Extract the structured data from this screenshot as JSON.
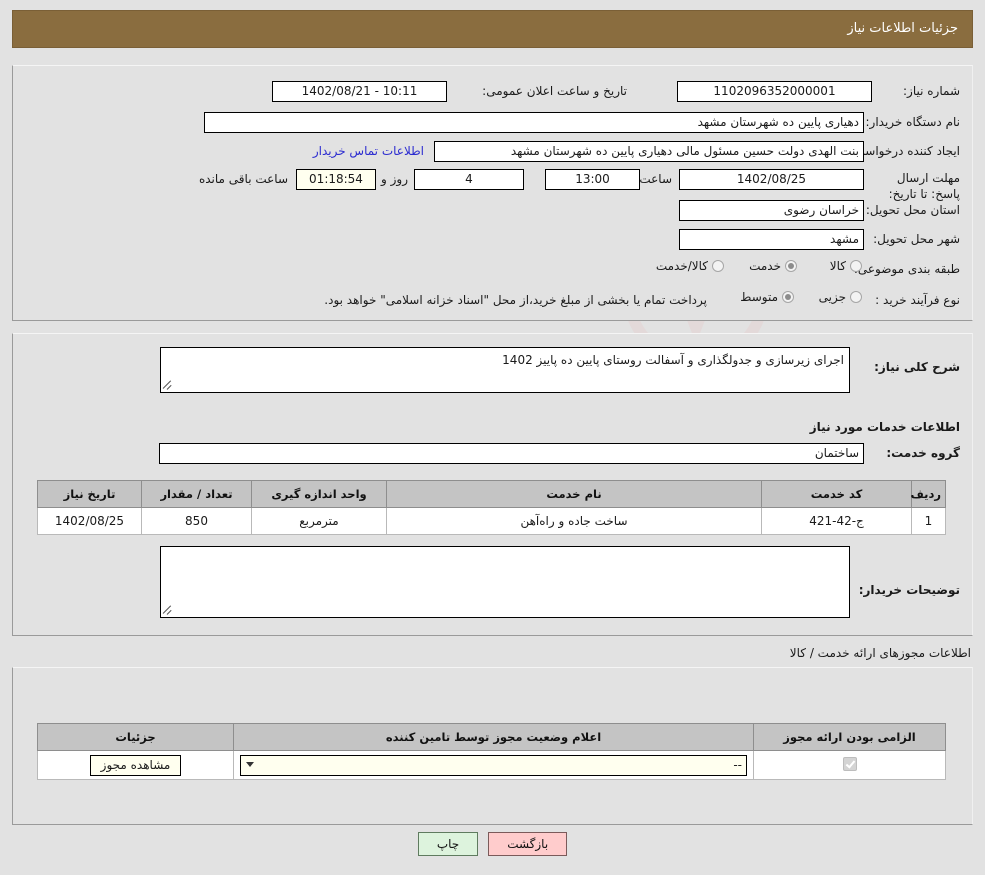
{
  "header": {
    "title": "جزئیات اطلاعات نیاز"
  },
  "watermark": {
    "text": "AriaTender.net"
  },
  "fields": {
    "need_number_label": "شماره نیاز:",
    "need_number_value": "1102096352000001",
    "public_announce_label": "تاریخ و ساعت اعلان عمومی:",
    "public_announce_value": "1402/08/21 - 10:11",
    "buyer_org_label": "نام دستگاه خریدار:",
    "buyer_org_value": "دهیاری پایین ده  شهرستان مشهد",
    "creator_label": "ایجاد کننده درخواست:",
    "creator_value": "بنت الهدی دولت حسین مسئول مالی  دهیاری پایین ده  شهرستان مشهد",
    "contact_link": "اطلاعات تماس خرید‌ار",
    "deadline_label": "مهلت ارسال پاسخ: تا تاریخ:",
    "deadline_date": "1402/08/25",
    "hour_label": "ساعت",
    "deadline_time": "13:00",
    "days_value": "4",
    "days_and_label": "روز و",
    "countdown_value": "01:18:54",
    "remaining_label": "ساعت باقی مانده",
    "province_label": "استان محل تحویل:",
    "province_value": "خراسان رضوی",
    "city_label": "شهر محل تحویل:",
    "city_value": "مشهد",
    "category_label": "طبقه بندی موضوعی:",
    "process_label": "نوع فرآیند خرید :",
    "payment_note": "پرداخت تمام یا بخشی از مبلغ خرید،از محل \"اسناد خزانه اسلامی\" خواهد بود."
  },
  "category_options": [
    {
      "label": "کالا",
      "selected": false
    },
    {
      "label": "خدمت",
      "selected": true
    },
    {
      "label": "کالا/خدمت",
      "selected": false
    }
  ],
  "process_options": [
    {
      "label": "جزیی",
      "selected": false
    },
    {
      "label": "متوسط",
      "selected": true
    }
  ],
  "detail": {
    "summary_label": "شرح کلی نیاز:",
    "summary_value": "اجرای زیرسازی و جدولگذاری و آسفالت روستای پایین ده پاییز 1402",
    "services_heading": "اطلاعات خدمات مورد نیاز",
    "service_group_label": "گروه خدمت:",
    "service_group_value": "ساختمان",
    "buyer_notes_label": "توضیحات خریدار:",
    "buyer_notes_value": ""
  },
  "services_table": {
    "columns": [
      "ردیف",
      "کد خدمت",
      "نام خدمت",
      "واحد اندازه گیری",
      "تعداد / مقدار",
      "تاریخ نیاز"
    ],
    "rows": [
      {
        "row": "1",
        "code": "ج-42-421",
        "name": "ساخت جاده و راه‌آهن",
        "unit": "مترمربع",
        "qty": "850",
        "date": "1402/08/25"
      }
    ]
  },
  "permits": {
    "section_note": "اطلاعات مجوزهای ارائه خدمت / کالا",
    "columns": [
      "الزامی بودن ارائه مجوز",
      "اعلام وضعیت مجوز توسط تامین کننده",
      "جزئیات"
    ],
    "rows": [
      {
        "required": true,
        "status_value": "--",
        "details_button": "مشاهده مجوز"
      }
    ]
  },
  "footer": {
    "back_label": "بازگشت",
    "print_label": "چاپ"
  }
}
